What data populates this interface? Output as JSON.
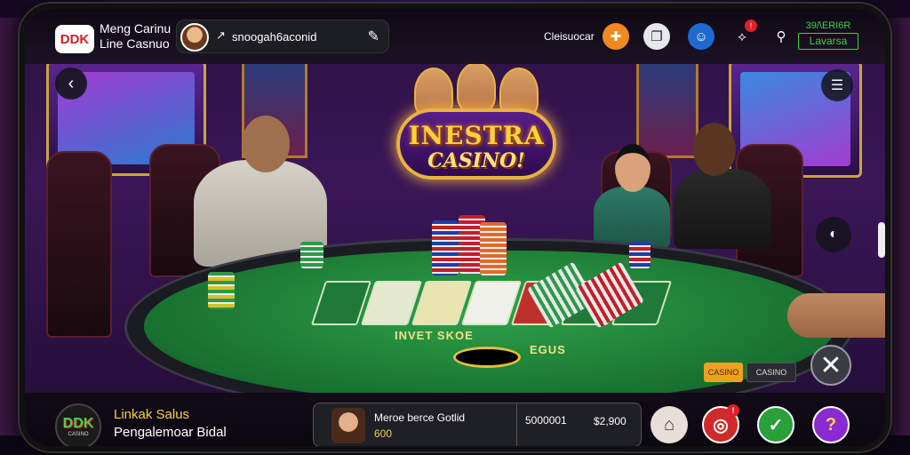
{
  "header": {
    "brand_logo_text": "DDK",
    "brand_name_line1": "Meng Carinu",
    "brand_name_line2": "Line Casnuo",
    "search_text": "snoogah6aconid",
    "label": "Cleisuocar",
    "balance_line1": "39/\\ERI6R",
    "balance_value": "Lavarsa"
  },
  "hero": {
    "logo_line1": "INESTRA",
    "logo_line2": "CASINO!"
  },
  "table": {
    "felt_text1": "INVET SKOE",
    "felt_text2": "EGUS"
  },
  "overlays": {
    "tag_orange": "CASINO",
    "tag_grey": "CASINO"
  },
  "bottom": {
    "logo_text": "DDK",
    "logo_sub": "CASINO",
    "title": "Linkak Salus",
    "subtitle": "Pengalemoar Bidal",
    "player_name": "Meroe berce Gotlid",
    "player_value": "600",
    "number": "5000001",
    "amount": "$2,900"
  },
  "colors": {
    "accent_gold": "#f4d24a",
    "accent_green": "#3cd24a",
    "felt_green": "#146a2c",
    "alert_red": "#e0202a"
  }
}
